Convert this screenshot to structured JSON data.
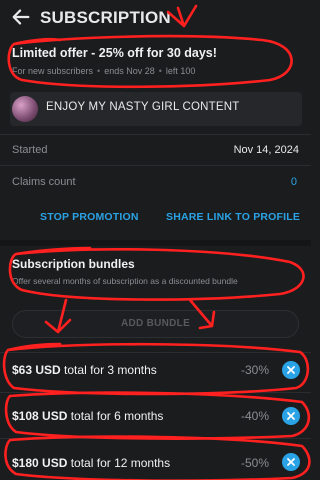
{
  "header": {
    "title": "SUBSCRIPTION"
  },
  "offer": {
    "title": "Limited offer - 25% off for 30 days!",
    "audience": "For new subscribers",
    "ends": "ends Nov 28",
    "left": "left 100"
  },
  "message": {
    "text": "ENJOY MY NASTY GIRL CONTENT"
  },
  "info": {
    "started_label": "Started",
    "started_value": "Nov 14, 2024",
    "claims_label": "Claims count",
    "claims_value": "0"
  },
  "actions": {
    "stop": "STOP PROMOTION",
    "share": "SHARE LINK TO PROFILE"
  },
  "bundles": {
    "title": "Subscription bundles",
    "subtitle": "Offer several months of subscription as a discounted bundle",
    "add_label": "ADD BUNDLE",
    "items": [
      {
        "price": "$63 USD",
        "term": "total for 3 months",
        "discount": "-30%"
      },
      {
        "price": "$108 USD",
        "term": "total for 6 months",
        "discount": "-40%"
      },
      {
        "price": "$180 USD",
        "term": "total for 12 months",
        "discount": "-50%"
      }
    ]
  },
  "colors": {
    "accent": "#2aa3e6",
    "annotation": "#ff2020"
  }
}
